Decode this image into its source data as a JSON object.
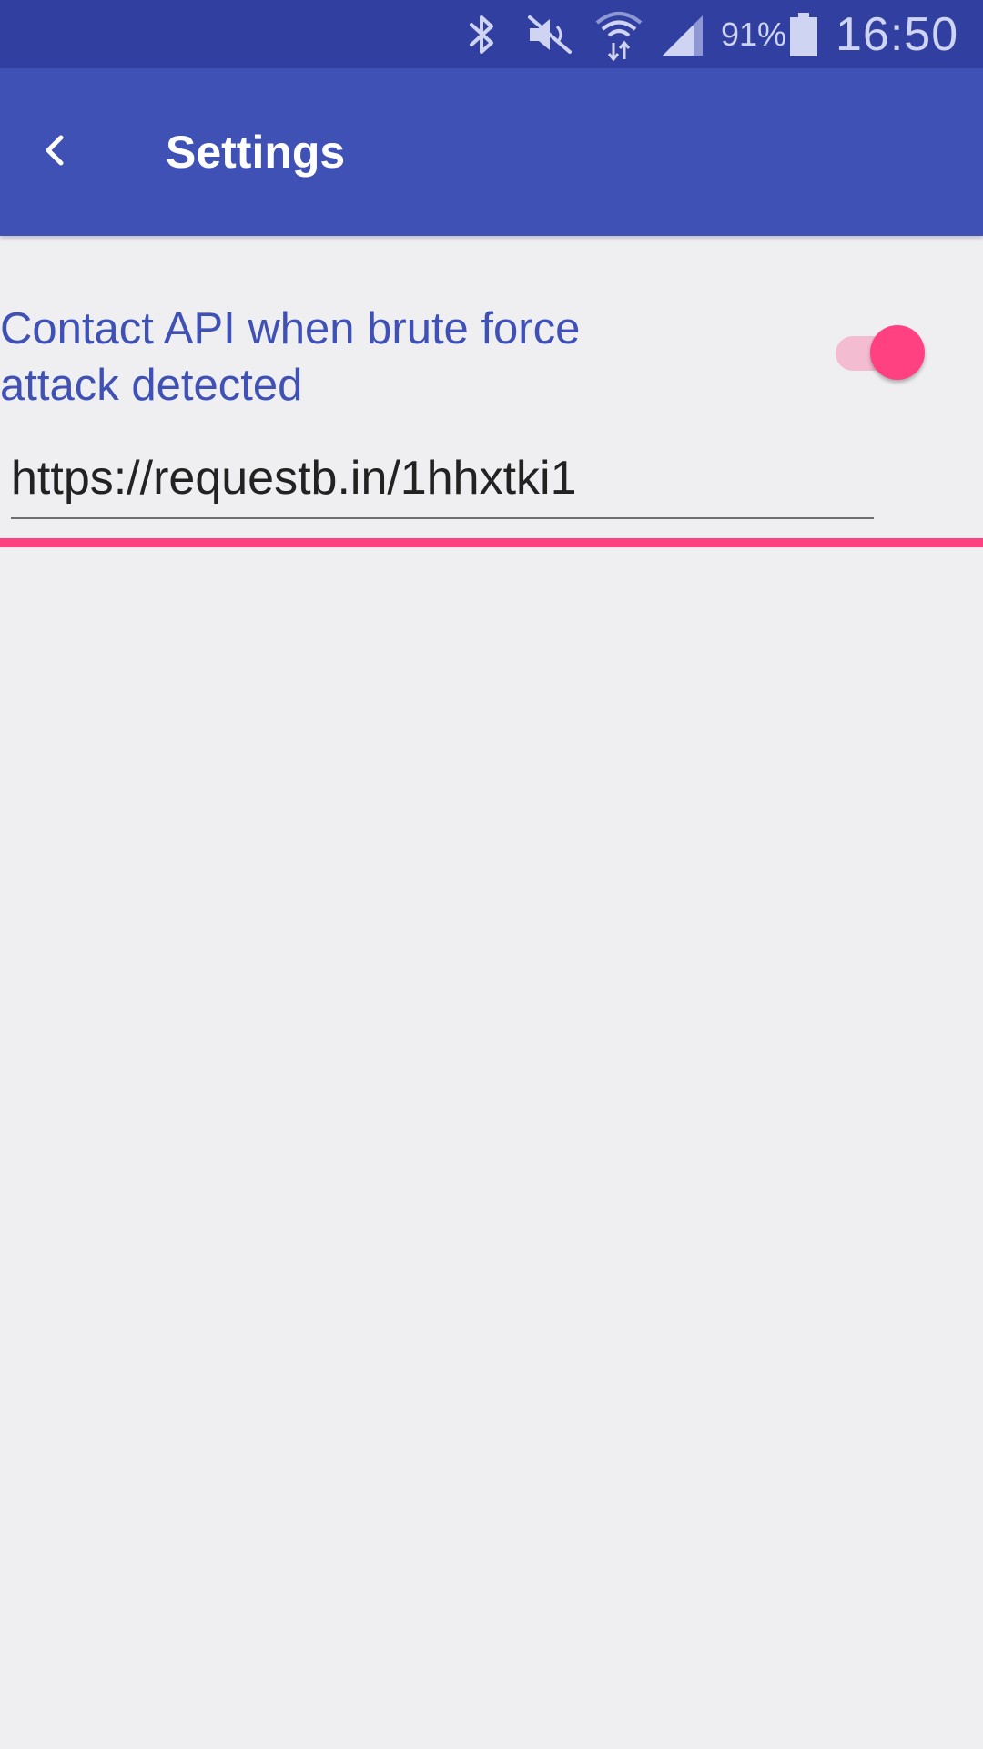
{
  "status_bar": {
    "battery_percent": "91%",
    "time": "16:50",
    "icons": [
      "bluetooth-icon",
      "mute-icon",
      "wifi-icon",
      "signal-icon",
      "battery-icon"
    ]
  },
  "app_bar": {
    "title": "Settings",
    "back_icon": "chevron-left-icon"
  },
  "preference": {
    "title": "Contact API when brute force attack detected",
    "toggle_on": true
  },
  "url_field": {
    "value": "https://requestb.in/1hhxtki1"
  },
  "colors": {
    "status_bar": "#3140a0",
    "app_bar": "#3f51b5",
    "accent": "#ff4081",
    "background": "#efeef0",
    "pref_title": "#3f51b5"
  }
}
